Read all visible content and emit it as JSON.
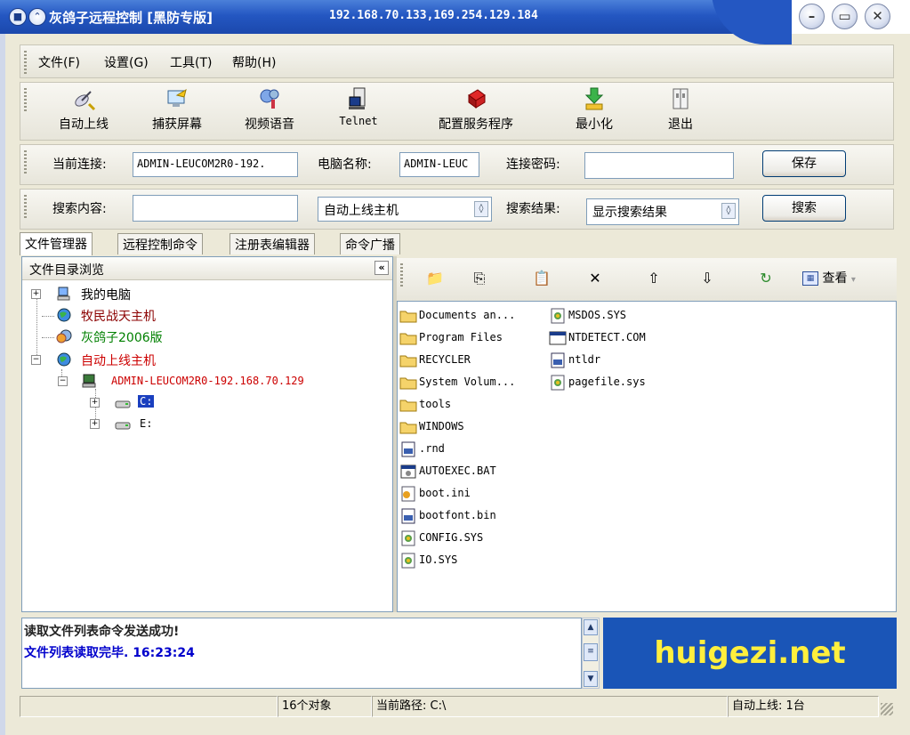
{
  "window": {
    "title": "灰鸽子远程控制 [黑防专版]",
    "ip": "192.168.70.133,169.254.129.184"
  },
  "menu": [
    "文件(F)",
    "设置(G)",
    "工具(T)",
    "帮助(H)"
  ],
  "toolbar": {
    "buttons": [
      {
        "label": "自动上线",
        "icon": "satellite-icon"
      },
      {
        "label": "捕获屏幕",
        "icon": "screen-capture-icon"
      },
      {
        "label": "视频语音",
        "icon": "video-voice-icon"
      },
      {
        "label": "Telnet",
        "icon": "telnet-terminal-icon"
      },
      {
        "label": "配置服务程序",
        "icon": "config-server-icon"
      },
      {
        "label": "最小化",
        "icon": "minimize-icon"
      },
      {
        "label": "退出",
        "icon": "exit-icon"
      }
    ]
  },
  "connection": {
    "current_label": "当前连接:",
    "current_value": "ADMIN-LEUCOM2R0-192.",
    "computer_label": "电脑名称:",
    "computer_value": "ADMIN-LEUC",
    "password_label": "连接密码:",
    "password_value": "",
    "save_label": "保存"
  },
  "search": {
    "content_label": "搜索内容:",
    "content_value": "",
    "scope_value": "自动上线主机",
    "result_label": "搜索结果:",
    "result_value": "显示搜索结果",
    "search_label": "搜索"
  },
  "tabs": [
    "文件管理器",
    "远程控制命令",
    "注册表编辑器",
    "命令广播"
  ],
  "tree": {
    "header": "文件目录浏览",
    "collapse": "«",
    "nodes": [
      {
        "label": "我的电脑",
        "color": "#000000"
      },
      {
        "label": "牧民战天主机",
        "color": "#8b0000"
      },
      {
        "label": "灰鸽子2006版",
        "color": "#008000"
      },
      {
        "label": "自动上线主机",
        "color": "#cc0000"
      },
      {
        "label": "ADMIN-LEUCOM2R0-192.168.70.129",
        "color": "#cc0000"
      },
      {
        "label": "C:",
        "color": "#ffffff"
      },
      {
        "label": "E:",
        "color": "#000000"
      }
    ]
  },
  "filetoolbar": {
    "view_label": "查看"
  },
  "files": {
    "col1": [
      {
        "name": "Documents an...",
        "icon": "folder-icon"
      },
      {
        "name": "Program Files",
        "icon": "folder-icon"
      },
      {
        "name": "RECYCLER",
        "icon": "folder-icon"
      },
      {
        "name": "System Volum...",
        "icon": "folder-icon"
      },
      {
        "name": "tools",
        "icon": "folder-icon"
      },
      {
        "name": "WINDOWS",
        "icon": "folder-icon"
      },
      {
        "name": ".rnd",
        "icon": "file-icon"
      },
      {
        "name": "AUTOEXEC.BAT",
        "icon": "batch-file-icon"
      },
      {
        "name": "boot.ini",
        "icon": "ini-file-icon"
      },
      {
        "name": "bootfont.bin",
        "icon": "file-icon"
      },
      {
        "name": "CONFIG.SYS",
        "icon": "system-file-icon"
      },
      {
        "name": "IO.SYS",
        "icon": "system-file-icon"
      }
    ],
    "col2": [
      {
        "name": "MSDOS.SYS",
        "icon": "system-file-icon"
      },
      {
        "name": "NTDETECT.COM",
        "icon": "com-file-icon"
      },
      {
        "name": "ntldr",
        "icon": "file-icon"
      },
      {
        "name": "pagefile.sys",
        "icon": "system-file-icon"
      }
    ]
  },
  "log": {
    "line1": "读取文件列表命令发送成功!",
    "line2": "文件列表读取完毕. 16:23:24"
  },
  "banner": "huigezi.net",
  "status": {
    "objects": "16个对象",
    "path": "当前路径: C:\\",
    "online": "自动上线: 1台"
  }
}
